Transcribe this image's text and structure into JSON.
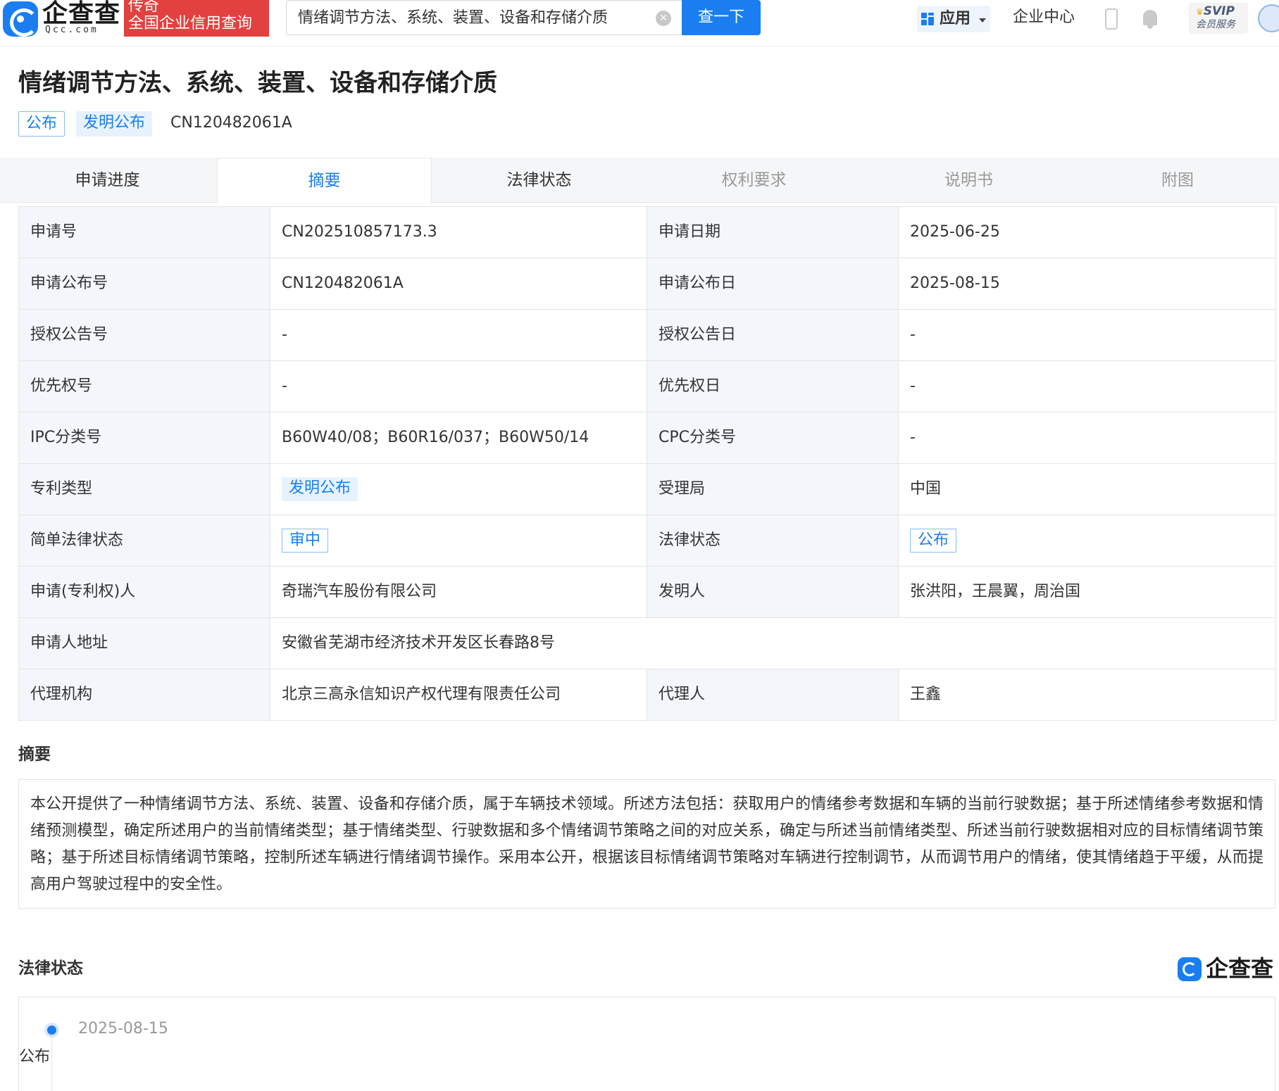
{
  "header": {
    "logo_text": "企查查",
    "logo_sub": "Qcc.com",
    "badge_line1": "传奇",
    "badge_line2": "全国企业信用查询",
    "search_value": "情绪调节方法、系统、装置、设备和存储介质",
    "search_button": "查一下",
    "nav_app": "应用",
    "nav_enterprise_center": "企业中心",
    "svip_line1": "SVIP",
    "svip_line2": "会员服务"
  },
  "patent": {
    "title": "情绪调节方法、系统、装置、设备和存储介质",
    "tags": [
      "公布",
      "发明公布"
    ],
    "publication_number": "CN120482061A"
  },
  "tabs": [
    {
      "label": "申请进度"
    },
    {
      "label": "摘要"
    },
    {
      "label": "法律状态"
    },
    {
      "label": "权利要求"
    },
    {
      "label": "说明书"
    },
    {
      "label": "附图"
    }
  ],
  "info": {
    "application_no_label": "申请号",
    "application_no": "CN202510857173.3",
    "application_date_label": "申请日期",
    "application_date": "2025-06-25",
    "publication_no_label": "申请公布号",
    "publication_no": "CN120482061A",
    "publication_date_label": "申请公布日",
    "publication_date": "2025-08-15",
    "grant_no_label": "授权公告号",
    "grant_no": "-",
    "grant_date_label": "授权公告日",
    "grant_date": "-",
    "priority_no_label": "优先权号",
    "priority_no": "-",
    "priority_date_label": "优先权日",
    "priority_date": "-",
    "ipc_label": "IPC分类号",
    "ipc": "B60W40/08；B60R16/037；B60W50/14",
    "cpc_label": "CPC分类号",
    "cpc": "-",
    "patent_type_label": "专利类型",
    "patent_type": "发明公布",
    "office_label": "受理局",
    "office": "中国",
    "simple_legal_status_label": "简单法律状态",
    "simple_legal_status": "审中",
    "legal_status_label": "法律状态",
    "legal_status": "公布",
    "applicant_label": "申请(专利权)人",
    "applicant": "奇瑞汽车股份有限公司",
    "inventor_label": "发明人",
    "inventor": "张洪阳，王晨翼，周治国",
    "address_label": "申请人地址",
    "address": "安徽省芜湖市经济技术开发区长春路8号",
    "agency_label": "代理机构",
    "agency": "北京三高永信知识产权代理有限责任公司",
    "agent_label": "代理人",
    "agent": "王鑫"
  },
  "abstract": {
    "heading": "摘要",
    "text": "本公开提供了一种情绪调节方法、系统、装置、设备和存储介质，属于车辆技术领域。所述方法包括：获取用户的情绪参考数据和车辆的当前行驶数据；基于所述情绪参考数据和情绪预测模型，确定所述用户的当前情绪类型；基于情绪类型、行驶数据和多个情绪调节策略之间的对应关系，确定与所述当前情绪类型、所述当前行驶数据相对应的目标情绪调节策略；基于所述目标情绪调节策略，控制所述车辆进行情绪调节操作。采用本公开，根据该目标情绪调节策略对车辆进行控制调节，从而调节用户的情绪，使其情绪趋于平缓，从而提高用户驾驶过程中的安全性。"
  },
  "legal": {
    "heading": "法律状态",
    "brand": "企查查",
    "events": [
      {
        "date": "2025-08-15",
        "status": "公布"
      }
    ]
  }
}
